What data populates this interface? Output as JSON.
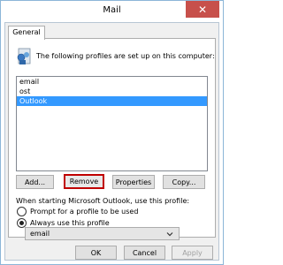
{
  "window": {
    "title": "Mail",
    "close_glyph": "✕"
  },
  "tab": {
    "label": "General"
  },
  "intro": {
    "text": "The following profiles are set up on this computer:",
    "icon": "profiles-icon"
  },
  "profiles": {
    "items": [
      "email",
      "ost",
      "Outlook"
    ],
    "selected": "Outlook"
  },
  "buttons": {
    "add": "Add...",
    "remove": "Remove",
    "properties": "Properties",
    "copy": "Copy..."
  },
  "startup": {
    "label": "When starting Microsoft Outlook, use this profile:",
    "prompt_label": "Prompt for a profile to be used",
    "always_label": "Always use this profile",
    "selected_option": "always",
    "profile_select": "email"
  },
  "footer": {
    "ok": "OK",
    "cancel": "Cancel",
    "apply": "Apply"
  },
  "colors": {
    "selection": "#3399ff",
    "close": "#c7504b",
    "highlight_border": "#c00000",
    "disabled_text": "#a0a0a0"
  }
}
